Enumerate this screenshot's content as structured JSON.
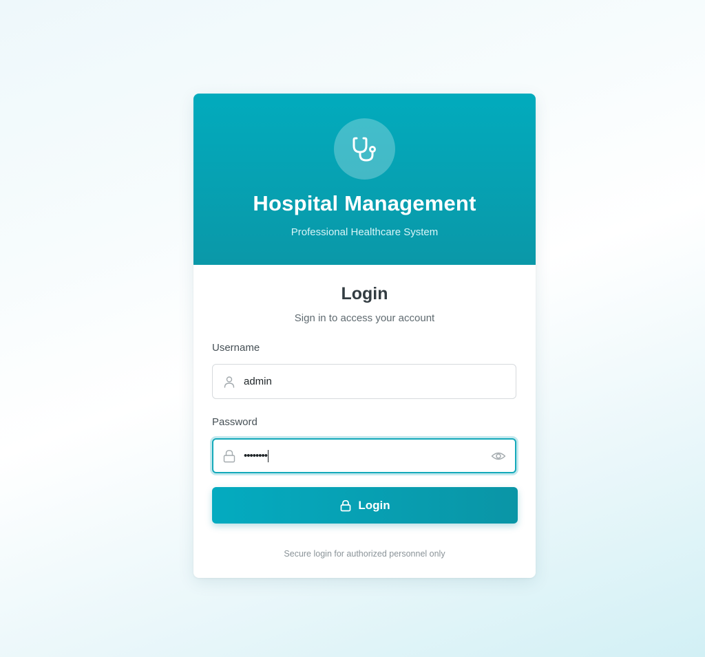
{
  "header": {
    "logo_icon": "stethoscope-icon",
    "title": "Hospital Management",
    "subtitle": "Professional Healthcare System",
    "brand_color": "#02abbd"
  },
  "login": {
    "title": "Login",
    "subtitle": "Sign in to access your account"
  },
  "username": {
    "label": "Username",
    "value": "admin",
    "icon": "user-icon"
  },
  "password": {
    "label": "Password",
    "masked_value": "••••••••",
    "icon": "lock-icon",
    "toggle_icon": "eye-icon"
  },
  "login_button": {
    "label": "Login",
    "icon": "lock-icon"
  },
  "footer": {
    "note": "Secure login for authorized personnel only"
  }
}
